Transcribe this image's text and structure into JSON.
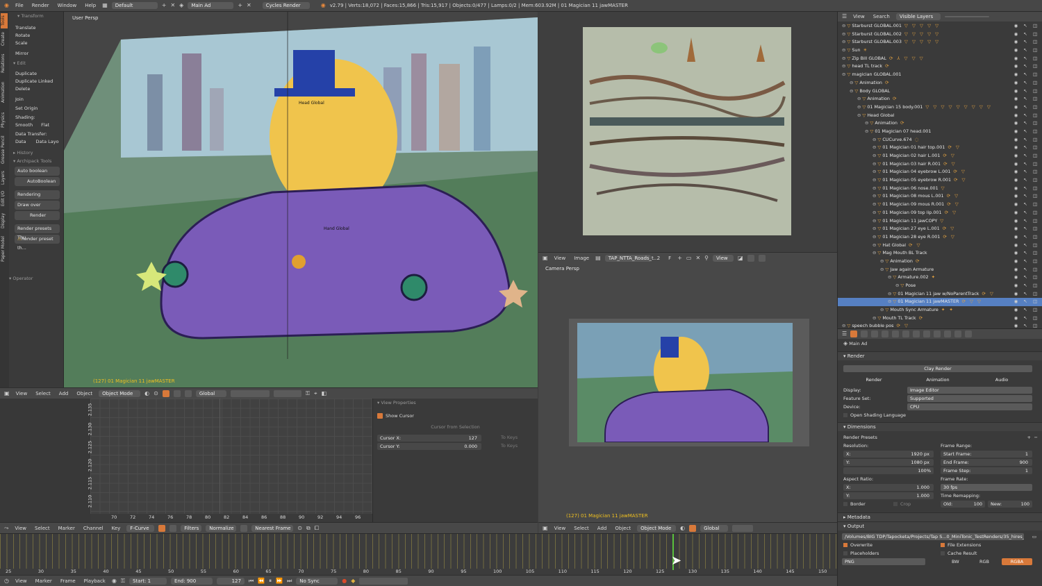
{
  "topbar": {
    "menus": [
      "File",
      "Render",
      "Window",
      "Help"
    ],
    "layout": "Default",
    "scene": "Main Ad",
    "engine": "Cycles Render",
    "stats": "v2.79 | Verts:18,072 | Faces:15,866 | Tris:15,917 | Objects:0/477 | Lamps:0/2 | Mem:603.92M | 01 Magician 11 jawMASTER"
  },
  "toolshelf": {
    "tabs": [
      "Tools",
      "Create",
      "Relations",
      "Animation",
      "Physics",
      "Grease Pencil",
      "Layers",
      "Edit I/O",
      "Display",
      "Paper Model"
    ],
    "transform_header": "Transform",
    "transform": [
      "Translate",
      "Rotate",
      "Scale"
    ],
    "mirror": "Mirror",
    "edit_header": "Edit",
    "edit": [
      "Duplicate",
      "Duplicate Linked",
      "Delete"
    ],
    "join": "Join",
    "set_origin": "Set Origin",
    "shading_label": "Shading:",
    "smooth": "Smooth",
    "flat": "Flat",
    "data_transfer": "Data Transfer:",
    "data": "Data",
    "data_layo": "Data Layo",
    "history": "History",
    "archipack": "Archipack Tools",
    "auto_boolean": "Auto boolean",
    "autoboolean": "AutoBoolean",
    "rendering": "Rendering",
    "draw_over": "Draw over",
    "render": "Render",
    "render_presets": "Render presets Thu...",
    "render_preset_th": "Render preset th...",
    "operator": "Operator"
  },
  "viewport": {
    "label": "User Persp",
    "object_label": "(127) 01 Magician 11 jawMASTER",
    "labels": [
      "Head Global",
      "Hand Global"
    ]
  },
  "viewport_header": {
    "menus": [
      "View",
      "Select",
      "Add",
      "Object"
    ],
    "mode": "Object Mode",
    "orientation": "Global"
  },
  "image_editor": {
    "menus": [
      "View",
      "Image"
    ],
    "image_name": "TAP_NTTA_Roads_t...",
    "users": "2",
    "f": "F",
    "view": "View"
  },
  "camera_view": {
    "label": "Camera Persp",
    "object_label": "(127) 01 Magician 11 jawMASTER",
    "menus": [
      "View",
      "Select",
      "Add",
      "Object"
    ],
    "mode": "Object Mode",
    "orientation": "Global"
  },
  "graph": {
    "y_ticks": [
      "2.135",
      "2.130",
      "2.125",
      "2.120",
      "2.115",
      "2.110"
    ],
    "x_ticks": [
      "70",
      "72",
      "74",
      "76",
      "78",
      "80",
      "82",
      "84",
      "86",
      "88",
      "90",
      "92",
      "94",
      "96"
    ],
    "menus": [
      "View",
      "Select",
      "Marker",
      "Channel",
      "Key"
    ],
    "mode": "F-Curve",
    "filters": "Filters",
    "normalize": "Normalize",
    "snap": "Nearest Frame"
  },
  "view_props": {
    "title": "View Properties",
    "show_cursor": "Show Cursor",
    "cursor_from_selection": "Cursor from Selection",
    "cursor_x_label": "Cursor X:",
    "cursor_x": "127",
    "cursor_y_label": "Cursor Y:",
    "cursor_y": "0.000",
    "to_keys": "To Keys"
  },
  "timeline": {
    "ticks": [
      "25",
      "30",
      "35",
      "40",
      "45",
      "50",
      "55",
      "60",
      "65",
      "70",
      "75",
      "80",
      "85",
      "90",
      "95",
      "100",
      "105",
      "110",
      "115",
      "120",
      "125",
      "130",
      "135",
      "140",
      "145",
      "150"
    ],
    "menus": [
      "View",
      "Marker",
      "Frame",
      "Playback"
    ],
    "start_label": "Start:",
    "start": "1",
    "end_label": "End:",
    "end": "900",
    "current": "127",
    "sync": "No Sync"
  },
  "outliner": {
    "menus": [
      "View",
      "Search"
    ],
    "filter": "Visible Layers",
    "rows": [
      {
        "name": "Starburst GLOBAL.001",
        "indent": 0,
        "tag": "▽ ▽ ▽ ▽ ▽"
      },
      {
        "name": "Starburst GLOBAL.002",
        "indent": 0,
        "tag": "▽ ▽ ▽ ▽ ▽"
      },
      {
        "name": "Starburst GLOBAL.003",
        "indent": 0,
        "tag": "▽ ▽ ▽ ▽ ▽"
      },
      {
        "name": "Sun",
        "indent": 0,
        "tag": "☀"
      },
      {
        "name": "Zip Bill GLOBAL",
        "indent": 0,
        "tag": "⟳ ⅄ ▽ ▽ ▽"
      },
      {
        "name": "head TL track",
        "indent": 0,
        "tag": "⟳"
      },
      {
        "name": "magician GLOBAL.001",
        "indent": 0,
        "tag": ""
      },
      {
        "name": "Animation",
        "indent": 1,
        "tag": "⟳"
      },
      {
        "name": "Body GLOBAL",
        "indent": 1,
        "tag": ""
      },
      {
        "name": "Animation",
        "indent": 2,
        "tag": "⟳"
      },
      {
        "name": "01 Magician 15 body.001",
        "indent": 2,
        "tag": "▽ ▽ ▽ ▽ ▽ ▽ ▽ ▽ ▽"
      },
      {
        "name": "Head Global",
        "indent": 2,
        "tag": ""
      },
      {
        "name": "Animation",
        "indent": 3,
        "tag": "⟳"
      },
      {
        "name": "01 Magician 07 head.001",
        "indent": 3,
        "tag": ""
      },
      {
        "name": "CUCurve.674",
        "indent": 4,
        "tag": "◌"
      },
      {
        "name": "01 Magician 01 hair top.001",
        "indent": 4,
        "tag": "⟳ ▽"
      },
      {
        "name": "01 Magician 02 hair L.001",
        "indent": 4,
        "tag": "⟳ ▽"
      },
      {
        "name": "01 Magician 03 hair R.001",
        "indent": 4,
        "tag": "⟳ ▽"
      },
      {
        "name": "01 Magician 04 eyebrow L.001",
        "indent": 4,
        "tag": "⟳ ▽"
      },
      {
        "name": "01 Magician 05 eyebrow R.001",
        "indent": 4,
        "tag": "⟳ ▽"
      },
      {
        "name": "01 Magician 06 nose.001",
        "indent": 4,
        "tag": "▽"
      },
      {
        "name": "01 Magician 08 mous L.001",
        "indent": 4,
        "tag": "⟳ ▽"
      },
      {
        "name": "01 Magician 09 mous R.001",
        "indent": 4,
        "tag": "⟳ ▽"
      },
      {
        "name": "01 Magician 09 top lip.001",
        "indent": 4,
        "tag": "⟳ ▽"
      },
      {
        "name": "01 Magician 11 jawCOPY",
        "indent": 4,
        "tag": "▽"
      },
      {
        "name": "01 Magician 27 eye L.001",
        "indent": 4,
        "tag": "⟳ ▽"
      },
      {
        "name": "01 Magician 28 eye R.001",
        "indent": 4,
        "tag": "⟳ ▽"
      },
      {
        "name": "Hat Global",
        "indent": 4,
        "tag": "⟳ ▽"
      },
      {
        "name": "Mag Mouth BL Track",
        "indent": 4,
        "tag": ""
      },
      {
        "name": "Animation",
        "indent": 5,
        "tag": "⟳"
      },
      {
        "name": "Jaw again Armature",
        "indent": 5,
        "tag": ""
      },
      {
        "name": "Armature.002",
        "indent": 6,
        "tag": "✦"
      },
      {
        "name": "Pose",
        "indent": 7,
        "tag": ""
      },
      {
        "name": "01 Magician 11 jaw w/NoParentTrack",
        "indent": 6,
        "tag": "⟳ ▽"
      },
      {
        "name": "01 Magician 11 jawMASTER",
        "indent": 6,
        "tag": "⟳ ▽ ▽"
      },
      {
        "name": "Mouth Sync Armature",
        "indent": 5,
        "tag": "✦ ✦"
      },
      {
        "name": "Mouth TL Track",
        "indent": 4,
        "tag": "⟳"
      },
      {
        "name": "speech bubble pos",
        "indent": 0,
        "tag": "⟳ ▽"
      }
    ]
  },
  "properties": {
    "scene": "Main Ad",
    "render_header": "Render",
    "clay_render": "Clay Render",
    "render_btn": "Render",
    "animation_btn": "Animation",
    "audio_btn": "Audio",
    "display_label": "Display:",
    "display": "Image Editor",
    "feature_set_label": "Feature Set:",
    "feature_set": "Supported",
    "device_label": "Device:",
    "device": "CPU",
    "osl": "Open Shading Language",
    "dimensions_header": "Dimensions",
    "render_presets": "Render Presets",
    "resolution": "Resolution:",
    "res_x_label": "X:",
    "res_x": "1920 px",
    "res_y_label": "Y:",
    "res_y": "1080 px",
    "res_pct": "100%",
    "frame_range": "Frame Range:",
    "start_frame_label": "Start Frame:",
    "start_frame": "1",
    "end_frame_label": "End Frame:",
    "end_frame": "900",
    "frame_step_label": "Frame Step:",
    "frame_step": "1",
    "aspect_ratio": "Aspect Ratio:",
    "asp_x_label": "X:",
    "asp_x": "1.000",
    "asp_y_label": "Y:",
    "asp_y": "1.000",
    "frame_rate": "Frame Rate:",
    "fps": "30 fps",
    "time_remap": "Time Remapping:",
    "old_label": "Old:",
    "old": "100",
    "new_label": "New:",
    "new": "100",
    "border": "Border",
    "crop": "Crop",
    "metadata_header": "Metadata",
    "output_header": "Output",
    "output_path": "/Volumes/BIG TDP/Tapocketa/Projects/Tap S...0_MiniTonic_TestRenders/35_hires_LipSync/",
    "overwrite": "Overwrite",
    "file_extensions": "File Extensions",
    "placeholders": "Placeholders",
    "cache_result": "Cache Result",
    "format": "PNG",
    "bw": "BW",
    "rgb": "RGB",
    "rgba": "RGBA"
  },
  "colors": {
    "accent": "#d8793a",
    "bg": "#3d3d3d",
    "panel": "#3a3a3a",
    "header": "#484848",
    "selected": "#5680c2",
    "keyframe_line": "#d6c34a"
  }
}
